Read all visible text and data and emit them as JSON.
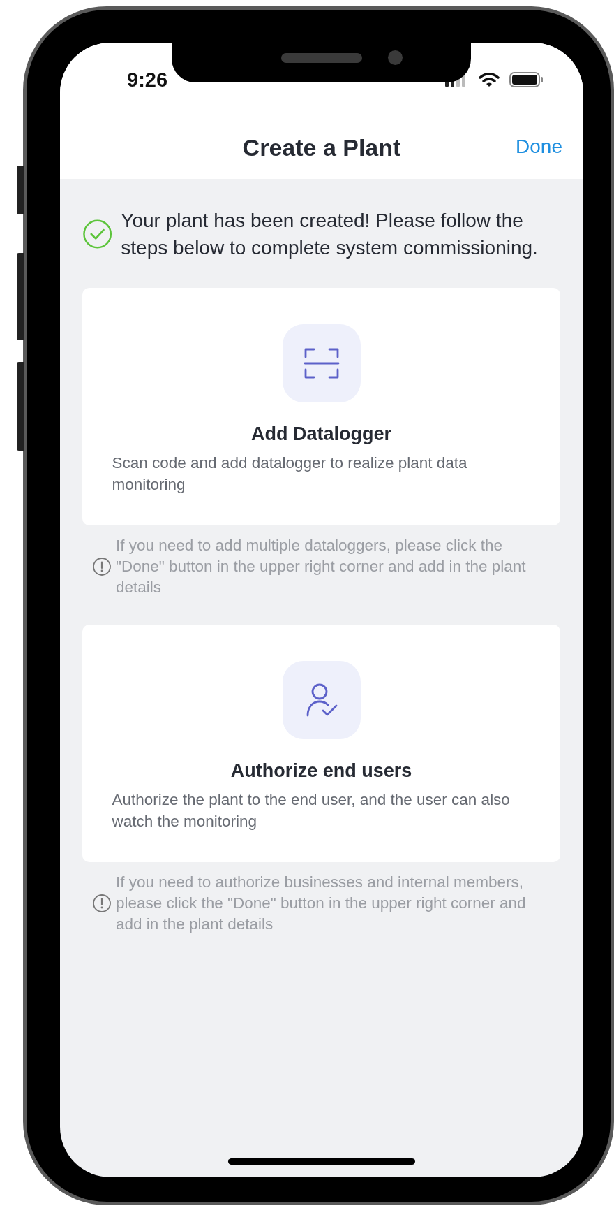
{
  "status_bar": {
    "time": "9:26"
  },
  "header": {
    "title": "Create a Plant",
    "action": "Done"
  },
  "success_message": "Your plant has been created! Please follow the steps below to complete system commissioning.",
  "steps": [
    {
      "kind": "datalogger",
      "title": "Add Datalogger",
      "description": "Scan code and add datalogger to realize plant data monitoring",
      "note": "If you need to add multiple dataloggers, please click the \"Done\" button in the upper right corner and add in the plant details"
    },
    {
      "kind": "users",
      "title": "Authorize end users",
      "description": "Authorize the plant to the end user, and the user can also watch the monitoring",
      "note": "If you need to authorize businesses and internal members, please click the \"Done\" button in the upper right corner and add in the plant details"
    }
  ]
}
